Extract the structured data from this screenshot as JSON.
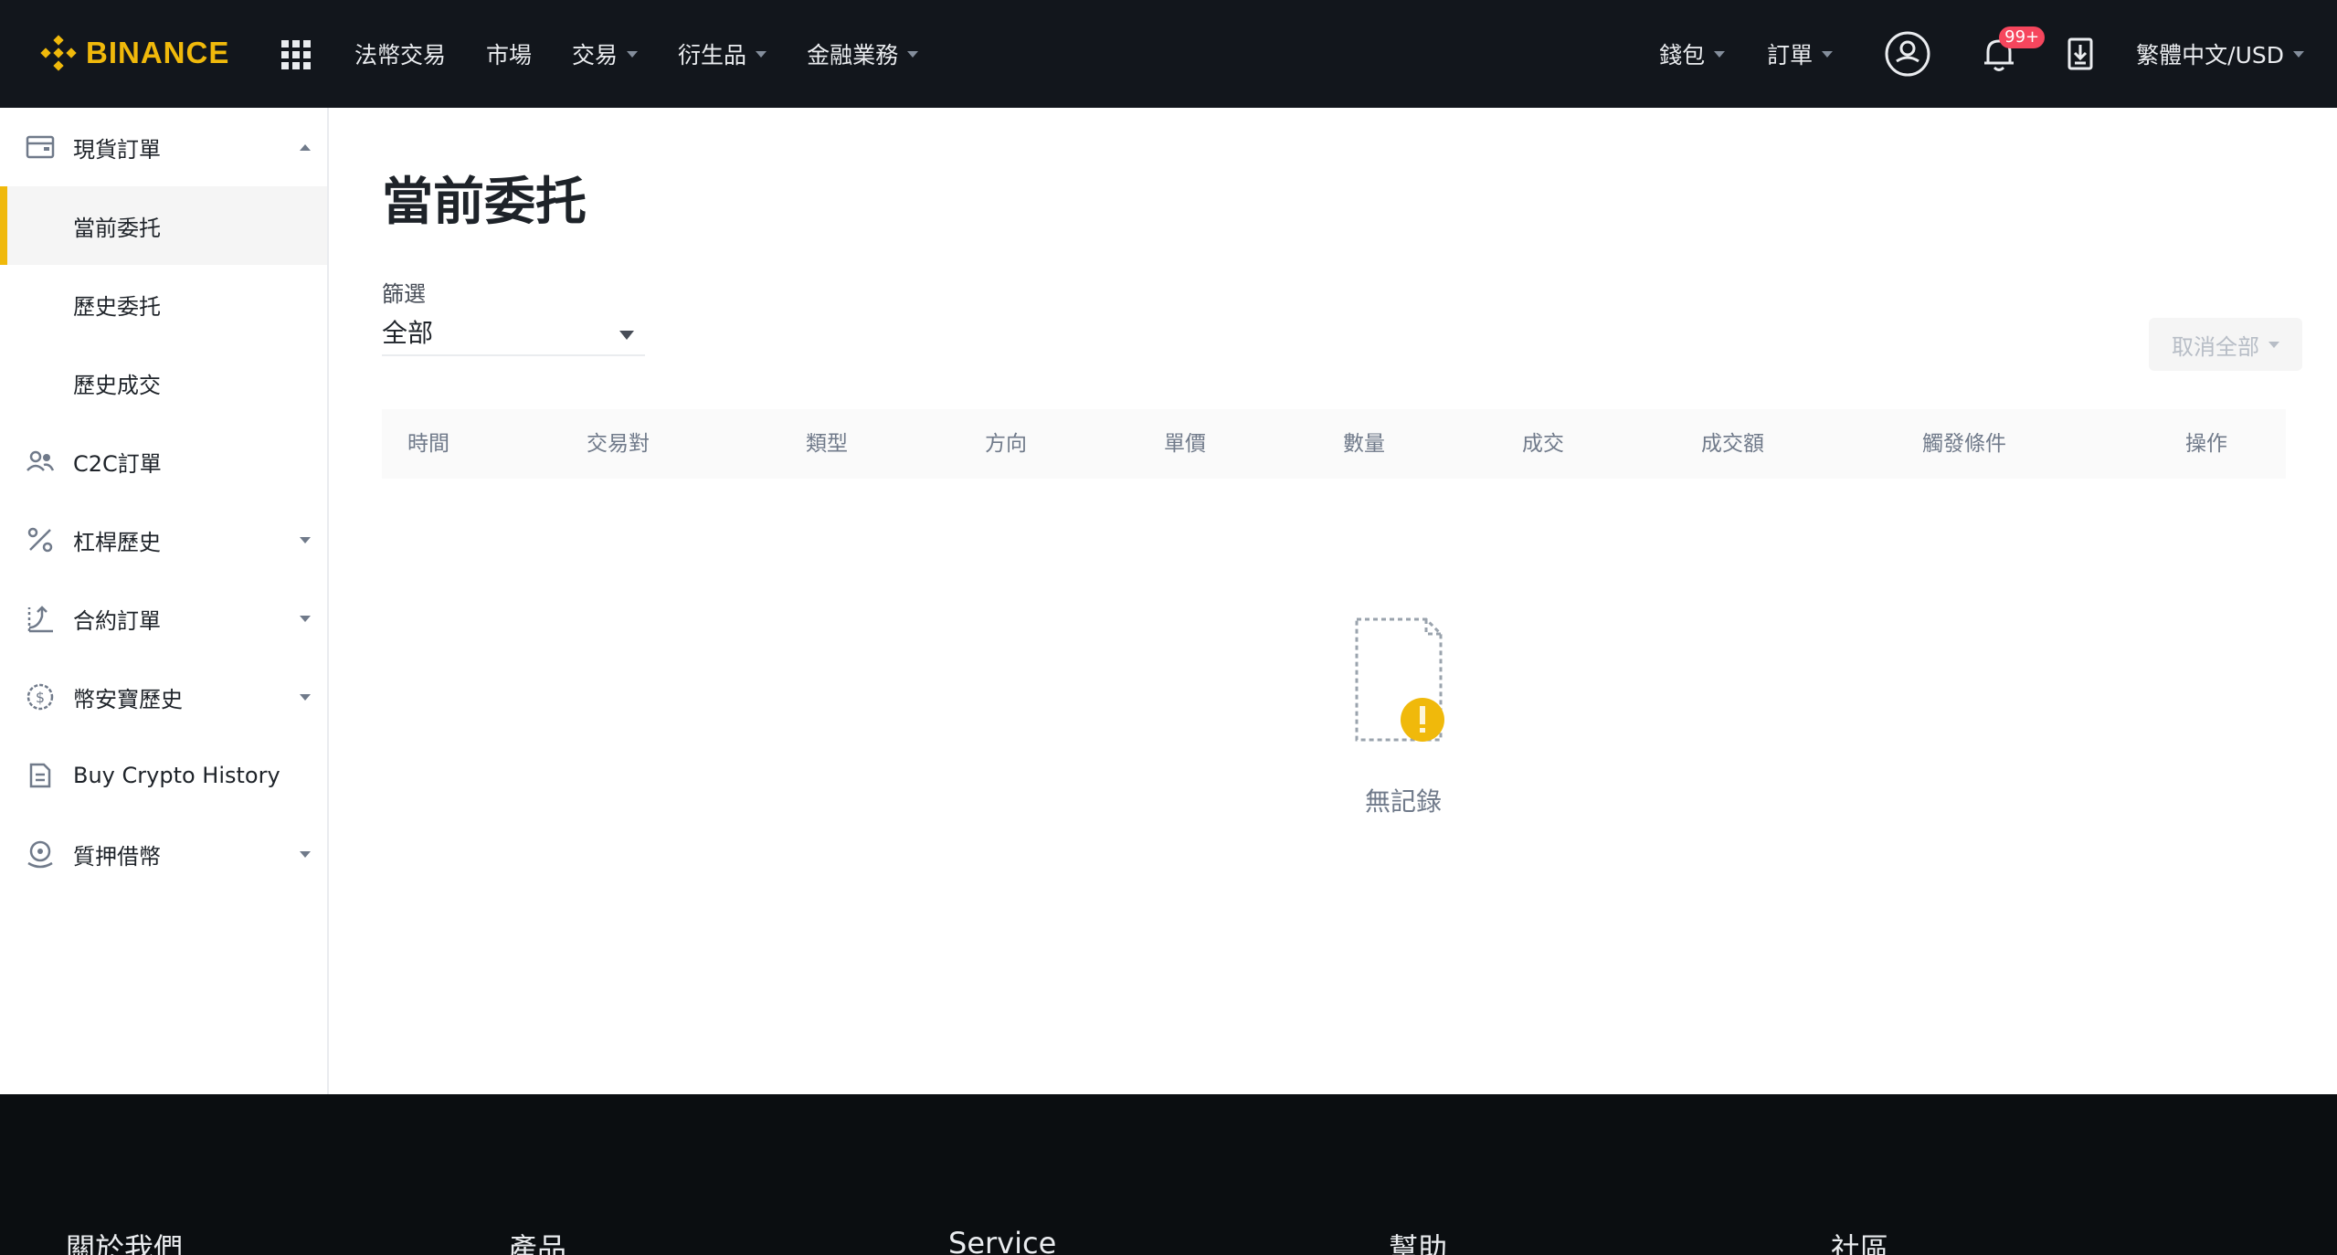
{
  "header": {
    "logo_text": "BINANCE",
    "nav": [
      {
        "label": "法幣交易",
        "dropdown": false
      },
      {
        "label": "市場",
        "dropdown": false
      },
      {
        "label": "交易",
        "dropdown": true
      },
      {
        "label": "衍生品",
        "dropdown": true
      },
      {
        "label": "金融業務",
        "dropdown": true
      }
    ],
    "wallet_label": "錢包",
    "orders_label": "訂單",
    "notification_badge": "99+",
    "language_label": "繁體中文/USD",
    "brand_color": "#F0B90B"
  },
  "sidebar": {
    "items": [
      {
        "label": "現貨訂單",
        "icon": "wallet-icon",
        "expanded": true,
        "children": [
          {
            "label": "當前委托",
            "active": true
          },
          {
            "label": "歷史委托",
            "active": false
          },
          {
            "label": "歷史成交",
            "active": false
          }
        ]
      },
      {
        "label": "C2C訂單",
        "icon": "users-icon"
      },
      {
        "label": "杠桿歷史",
        "icon": "percent-icon",
        "dropdown": true
      },
      {
        "label": "合約訂單",
        "icon": "futures-icon",
        "dropdown": true
      },
      {
        "label": "幣安寶歷史",
        "icon": "savings-icon",
        "dropdown": true
      },
      {
        "label": "Buy Crypto History",
        "icon": "document-icon"
      },
      {
        "label": "質押借幣",
        "icon": "loan-icon",
        "dropdown": true
      }
    ]
  },
  "main": {
    "title": "當前委托",
    "filter_label": "篩選",
    "filter_value": "全部",
    "cancel_all_label": "取消全部",
    "columns": [
      "時間",
      "交易對",
      "類型",
      "方向",
      "單價",
      "數量",
      "成交",
      "成交額",
      "觸發條件",
      "操作"
    ],
    "empty_text": "無記錄"
  },
  "footer": {
    "columns": [
      "關於我們",
      "產品",
      "Service",
      "幫助",
      "社區"
    ]
  }
}
